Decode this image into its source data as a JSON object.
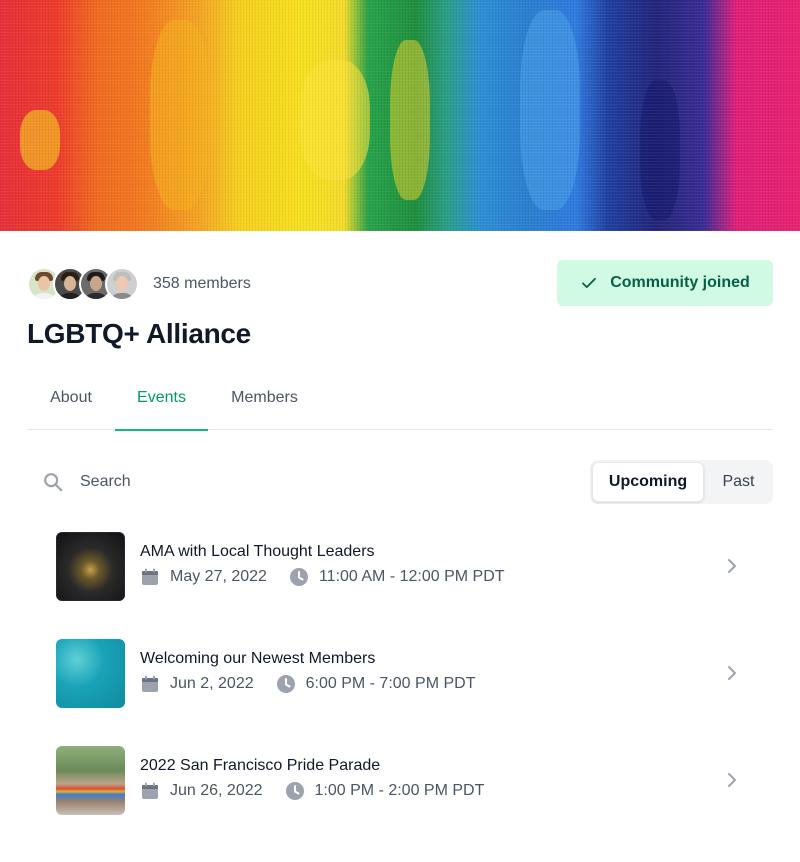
{
  "header": {
    "member_count": "358 members",
    "join_button_label": "Community joined",
    "community_name": "LGBTQ+ Alliance"
  },
  "tabs": [
    {
      "label": "About",
      "active": false
    },
    {
      "label": "Events",
      "active": true
    },
    {
      "label": "Members",
      "active": false
    }
  ],
  "search": {
    "placeholder": "Search"
  },
  "filter": {
    "options": [
      "Upcoming",
      "Past"
    ],
    "selected": "Upcoming"
  },
  "events": [
    {
      "title": "AMA with Local Thought Leaders",
      "date": "May 27, 2022",
      "time": "11:00 AM - 12:00 PM PDT"
    },
    {
      "title": "Welcoming our Newest Members",
      "date": "Jun 2, 2022",
      "time": "6:00 PM - 7:00 PM PDT"
    },
    {
      "title": "2022 San Francisco Pride Parade",
      "date": "Jun 26, 2022",
      "time": "1:00 PM - 2:00 PM PDT"
    }
  ],
  "colors": {
    "accent": "#059669",
    "joined_bg": "#d1fae5",
    "joined_text": "#065f46",
    "muted_text": "#4b5563",
    "icon_gray": "#9ca3af"
  },
  "icons": [
    "check-icon",
    "search-icon",
    "calendar-icon",
    "clock-icon",
    "chevron-right-icon"
  ]
}
